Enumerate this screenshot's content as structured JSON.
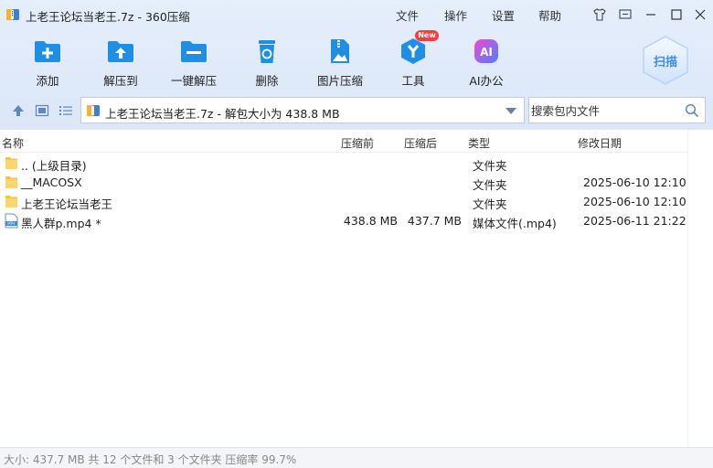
{
  "window": {
    "title": "上老王论坛当老王.7z - 360压缩",
    "menu": [
      "文件",
      "操作",
      "设置",
      "帮助"
    ],
    "controls": [
      "skin-icon",
      "feedback-icon",
      "minimize-icon",
      "maximize-icon",
      "close-icon"
    ]
  },
  "toolbar": {
    "items": [
      {
        "label": "添加",
        "icon": "add-folder-icon"
      },
      {
        "label": "解压到",
        "icon": "extract-to-icon"
      },
      {
        "label": "一键解压",
        "icon": "one-click-extract-icon"
      },
      {
        "label": "删除",
        "icon": "delete-icon"
      },
      {
        "label": "图片压缩",
        "icon": "image-compress-icon"
      },
      {
        "label": "工具",
        "icon": "tools-icon"
      },
      {
        "label": "AI办公",
        "icon": "ai-office-icon"
      }
    ],
    "new_badge": "New",
    "scan_label": "扫描"
  },
  "address": {
    "path": "上老王论坛当老王.7z - 解包大小为 438.8 MB"
  },
  "search": {
    "placeholder": "搜索包内文件"
  },
  "columns": [
    "名称",
    "压缩前",
    "压缩后",
    "类型",
    "修改日期"
  ],
  "files": [
    {
      "name": ".. (上级目录)",
      "before": "",
      "after": "",
      "type": "文件夹",
      "date": "",
      "icon": "folder-icon"
    },
    {
      "name": "__MACOSX",
      "before": "",
      "after": "",
      "type": "文件夹",
      "date": "2025-06-10 12:10",
      "icon": "folder-icon"
    },
    {
      "name": "上老王论坛当老王",
      "before": "",
      "after": "",
      "type": "文件夹",
      "date": "2025-06-10 12:10",
      "icon": "folder-icon"
    },
    {
      "name": "黑人群p.mp4 *",
      "before": "438.8 MB",
      "after": "437.7 MB",
      "type": "媒体文件(.mp4)",
      "date": "2025-06-11 21:22",
      "icon": "mp4-file-icon"
    }
  ],
  "status": "大小: 437.7 MB 共 12 个文件和 3 个文件夹 压缩率 99.7%",
  "colors": {
    "accent": "#3a8ef0",
    "badge": "#ff3b3b",
    "folder": "#f6c343"
  }
}
